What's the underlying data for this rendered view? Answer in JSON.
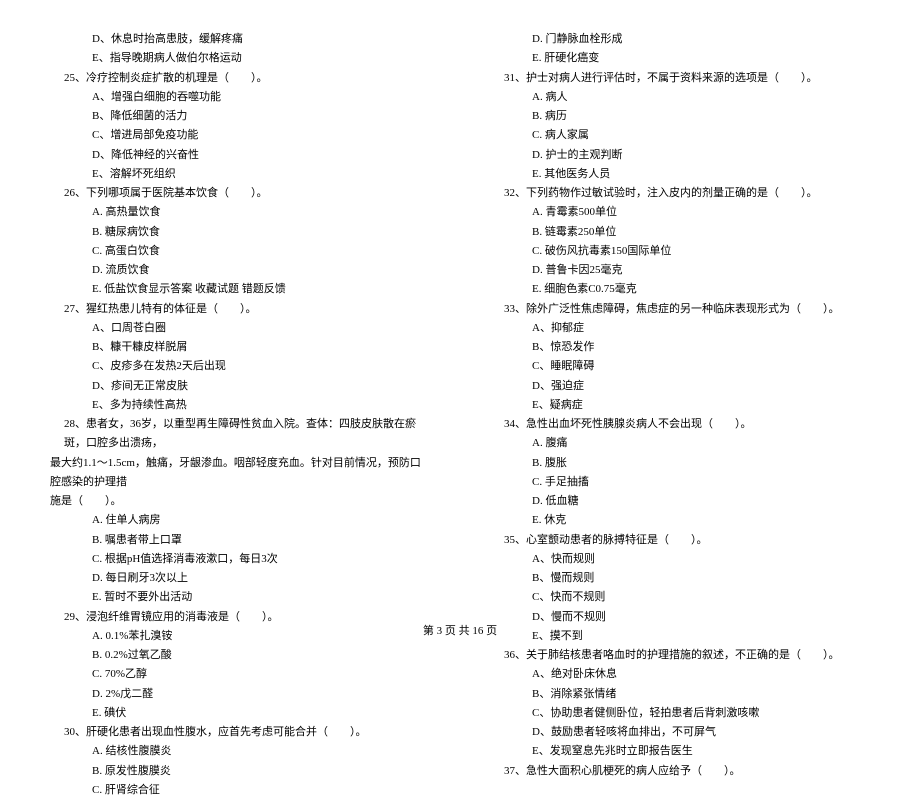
{
  "left": {
    "pre_options": [
      "D、休息时抬高患肢，缓解疼痛",
      "E、指导晚期病人做伯尔格运动"
    ],
    "q25": "25、冷疗控制炎症扩散的机理是（　　）。",
    "q25o": [
      "A、增强白细胞的吞噬功能",
      "B、降低细菌的活力",
      "C、增进局部免疫功能",
      "D、降低神经的兴奋性",
      "E、溶解坏死组织"
    ],
    "q26": "26、下列哪项属于医院基本饮食（　　）。",
    "q26o": [
      "A. 高热量饮食",
      "B. 糖尿病饮食",
      "C. 高蛋白饮食",
      "D. 流质饮食",
      "E. 低盐饮食显示答案  收藏试题  错题反馈"
    ],
    "q27": "27、猩红热患儿特有的体征是（　　）。",
    "q27o": [
      "A、口周苍白圈",
      "B、糠干糠皮样脱屑",
      "C、皮疹多在发热2天后出现",
      "D、疹间无正常皮肤",
      "E、多为持续性高热"
    ],
    "q28a": "28、患者女，36岁，以重型再生障碍性贫血入院。查体：四肢皮肤散在瘀斑，口腔多出溃疡，",
    "q28b": "最大约1.1～1.5cm，触痛，牙龈渗血。咽部轻度充血。针对目前情况，预防口腔感染的护理措",
    "q28c": "施是（　　）。",
    "q28o": [
      "A. 住单人病房",
      "B. 嘱患者带上口罩",
      "C. 根据pH值选择消毒液漱口，每日3次",
      "D. 每日刷牙3次以上",
      "E. 暂时不要外出活动"
    ],
    "q29": "29、浸泡纤维胃镜应用的消毒液是（　　）。",
    "q29o": [
      "A.  0.1%苯扎溴铵",
      "B.  0.2%过氧乙酸",
      "C.  70%乙醇",
      "D.  2%戊二醛",
      "E.  碘伏"
    ],
    "q30": "30、肝硬化患者出现血性腹水，应首先考虑可能合并（　　）。",
    "q30o": [
      "A.  结核性腹膜炎",
      "B.  原发性腹膜炎",
      "C.  肝肾综合征"
    ]
  },
  "right": {
    "pre_options": [
      "D.  门静脉血栓形成",
      "E.  肝硬化癌变"
    ],
    "q31": "31、护士对病人进行评估时，不属于资料来源的选项是（　　）。",
    "q31o": [
      "A. 病人",
      "B. 病历",
      "C. 病人家属",
      "D. 护士的主观判断",
      "E. 其他医务人员"
    ],
    "q32": "32、下列药物作过敏试验时，注入皮内的剂量正确的是（　　）。",
    "q32o": [
      "A. 青霉素500单位",
      "B. 链霉素250单位",
      "C. 破伤风抗毒素150国际单位",
      "D. 普鲁卡因25毫克",
      "E. 细胞色素C0.75毫克"
    ],
    "q33": "33、除外广泛性焦虑障碍，焦虑症的另一种临床表现形式为（　　）。",
    "q33o": [
      "A、抑郁症",
      "B、惊恐发作",
      "C、睡眠障碍",
      "D、强迫症",
      "E、疑病症"
    ],
    "q34": "34、急性出血坏死性胰腺炎病人不会出现（　　）。",
    "q34o": [
      "A. 腹痛",
      "B. 腹胀",
      "C. 手足抽搐",
      "D. 低血糖",
      "E. 休克"
    ],
    "q35": "35、心室颤动患者的脉搏特征是（　　）。",
    "q35o": [
      "A、快而规则",
      "B、慢而规则",
      "C、快而不规则",
      "D、慢而不规则",
      "E、摸不到"
    ],
    "q36": "36、关于肺结核患者咯血时的护理措施的叙述，不正确的是（　　）。",
    "q36o": [
      "A、绝对卧床休息",
      "B、消除紧张情绪",
      "C、协助患者健侧卧位，轻拍患者后背刺激咳嗽",
      "D、鼓励患者轻咳将血排出，不可屏气",
      "E、发现窒息先兆时立即报告医生"
    ],
    "q37": "37、急性大面积心肌梗死的病人应给予（　　）。"
  },
  "footer": "第 3 页 共 16 页"
}
